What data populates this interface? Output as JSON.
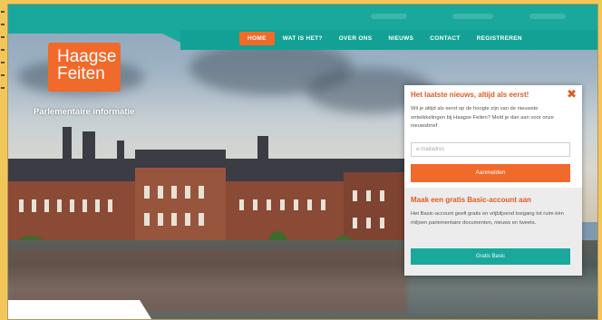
{
  "nav": {
    "items": [
      {
        "label": "HOME",
        "active": true
      },
      {
        "label": "WAT IS HET?",
        "active": false
      },
      {
        "label": "OVER ONS",
        "active": false
      },
      {
        "label": "NIEUWS",
        "active": false
      },
      {
        "label": "CONTACT",
        "active": false
      },
      {
        "label": "REGISTREREN",
        "active": false
      }
    ]
  },
  "logo": {
    "line1": "Haagse",
    "line2": "Feiten"
  },
  "tagline": "Parlementaire informatie",
  "popup": {
    "title": "Het laatste nieuws, altijd als eerst!",
    "close_icon": "close-x-icon",
    "text": "Wil je altijd als eerst op de hoogte zijn van de nieuwste ontwikkelingen bij Haagse Feiten? Meld je dan aan voor onze nieuwsbrief.",
    "email_placeholder": "e-mailadres",
    "subscribe_label": "Aanmelden",
    "basic_title": "Maak een gratis Basic-account aan",
    "basic_text": "Het Basic-account geeft gratis en vrijblijvend toegang tot ruim één miljoen parlementaire documenten, nieuws en tweets.",
    "basic_button": "Gratis Basic"
  },
  "colors": {
    "accent_orange": "#f06a2b",
    "teal": "#1aa89c",
    "frame_yellow": "#f2c75a"
  }
}
